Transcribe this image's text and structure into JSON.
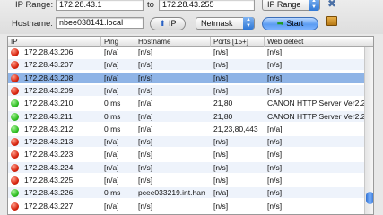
{
  "toolbar": {
    "ip_range_label": "IP Range:",
    "range_start": "172.28.43.1",
    "to_label": "to",
    "range_end": "172.28.43.255",
    "mode_select": "IP Range",
    "hostname_label": "Hostname:",
    "hostname_value": "nbee038141.local",
    "ip_button": "IP",
    "netmask_select": "Netmask",
    "start_button": "Start"
  },
  "columns": [
    "IP",
    "Ping",
    "Hostname",
    "Ports [15+]",
    "Web detect"
  ],
  "rows": [
    {
      "status": "dead",
      "ip": "172.28.43.206",
      "ping": "[n/a]",
      "hostname": "[n/s]",
      "ports": "[n/s]",
      "web": "[n/s]"
    },
    {
      "status": "dead",
      "ip": "172.28.43.207",
      "ping": "[n/a]",
      "hostname": "[n/s]",
      "ports": "[n/s]",
      "web": "[n/s]"
    },
    {
      "status": "dead",
      "ip": "172.28.43.208",
      "ping": "[n/a]",
      "hostname": "[n/s]",
      "ports": "[n/s]",
      "web": "[n/s]"
    },
    {
      "status": "dead",
      "ip": "172.28.43.209",
      "ping": "[n/a]",
      "hostname": "[n/s]",
      "ports": "[n/s]",
      "web": "[n/s]"
    },
    {
      "status": "alive",
      "ip": "172.28.43.210",
      "ping": "0 ms",
      "hostname": "[n/a]",
      "ports": "21,80",
      "web": "CANON HTTP Server Ver2.2"
    },
    {
      "status": "alive",
      "ip": "172.28.43.211",
      "ping": "0 ms",
      "hostname": "[n/a]",
      "ports": "21,80",
      "web": "CANON HTTP Server Ver2.2"
    },
    {
      "status": "alive",
      "ip": "172.28.43.212",
      "ping": "0 ms",
      "hostname": "[n/a]",
      "ports": "21,23,80,443",
      "web": "[n/a]"
    },
    {
      "status": "dead",
      "ip": "172.28.43.213",
      "ping": "[n/a]",
      "hostname": "[n/s]",
      "ports": "[n/s]",
      "web": "[n/s]"
    },
    {
      "status": "dead",
      "ip": "172.28.43.223",
      "ping": "[n/a]",
      "hostname": "[n/s]",
      "ports": "[n/s]",
      "web": "[n/s]"
    },
    {
      "status": "dead",
      "ip": "172.28.43.224",
      "ping": "[n/a]",
      "hostname": "[n/s]",
      "ports": "[n/s]",
      "web": "[n/s]"
    },
    {
      "status": "dead",
      "ip": "172.28.43.225",
      "ping": "[n/a]",
      "hostname": "[n/s]",
      "ports": "[n/s]",
      "web": "[n/s]"
    },
    {
      "status": "alive",
      "ip": "172.28.43.226",
      "ping": "0 ms",
      "hostname": "pcee033219.int.han",
      "ports": "[n/a]",
      "web": "[n/s]"
    },
    {
      "status": "dead",
      "ip": "172.28.43.227",
      "ping": "[n/a]",
      "hostname": "[n/s]",
      "ports": "[n/s]",
      "web": "[n/s]"
    }
  ],
  "selected_row": 2,
  "scroll_position": 0.93,
  "colors": {
    "selection": "#8fb4e6",
    "alive": "#2fbf23",
    "dead": "#d8250f"
  }
}
